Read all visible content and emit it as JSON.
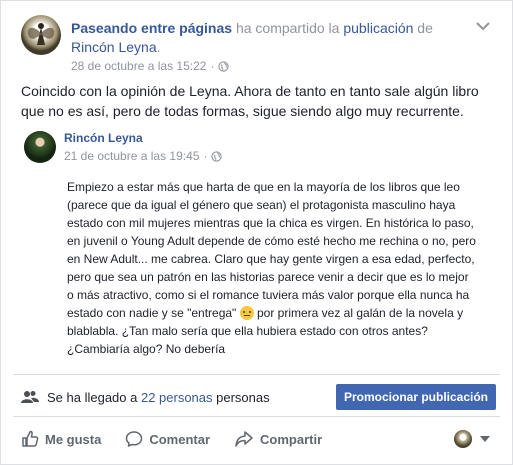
{
  "post": {
    "author": "Paseando entre páginas",
    "shared_text": " ha compartido la ",
    "publication_link": "publicación",
    "of_text": " de",
    "source_page": "Rincón Leyna",
    "period": ".",
    "timestamp": "28 de octubre a las 15:22",
    "separator": "·",
    "text": "Coincido con la opinión de Leyna. Ahora de tanto en tanto sale algún libro que no es así, pero de todas formas, sigue siendo algo muy recurrente."
  },
  "shared_post": {
    "author": "Rincón Leyna",
    "timestamp": "21 de octubre a las 19:45",
    "separator": "·",
    "text_part1": "Empiezo a estar más que harta de que en la mayoría de los libros que leo (parece que da igual el género que sean) el protagonista masculino haya estado con mil mujeres mientras que la chica es virgen. En histórica lo paso, en juvenil o Young Adult depende de cómo esté hecho me rechina o no, pero en New Adult... me cabrea. Claro que hay gente virgen a esa edad, perfecto, pero que sea un patrón en las historias parece venir a decir que es lo mejor o más atractivo, como si el romance tuviera más valor porque ella nunca ha estado con nadie y se \"entrega\" ",
    "text_part2": " por primera vez al galán de la novela y blablabla. ¿Tan malo sería que ella hubiera estado con otros antes? ¿Cambiaría algo? No debería",
    "emoji": "unamused-face"
  },
  "reach": {
    "prefix": "Se ha llegado a ",
    "count_link": "22 personas",
    "suffix": " personas",
    "icon": "people-icon"
  },
  "promote_button": "Promocionar publicación",
  "actions": {
    "like": "Me gusta",
    "comment": "Comentar",
    "share": "Compartir"
  },
  "colors": {
    "link": "#365899",
    "button": "#4267b2",
    "meta": "#90949c"
  }
}
